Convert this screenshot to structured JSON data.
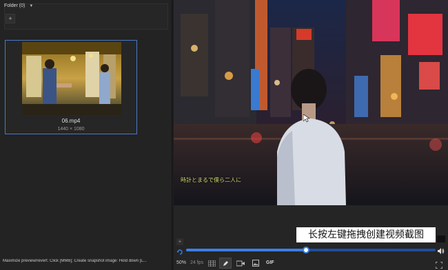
{
  "folder": {
    "title": "Folder (0)",
    "add_label": "+"
  },
  "media": [
    {
      "name": "06.mp4",
      "resolution": "1440 × 1080",
      "selected": true
    }
  ],
  "status_bar": {
    "text": "Maximize preview/revert: Click [MMB]; Create snapshot image: Hold down [L..."
  },
  "preview": {
    "subtitle": "時計とまるで僕ら二人に"
  },
  "player": {
    "add_label": "+",
    "progress": 0.48,
    "zoom": "50%",
    "fps": "24 fps",
    "gif_label": "GIF"
  },
  "overlay_tip": {
    "text": "长按左键拖拽创建视频截图"
  },
  "icons": [
    "chevron-down-icon",
    "loop-icon",
    "volume-icon",
    "grid-icon",
    "pen-icon",
    "video-icon",
    "image-icon",
    "fullscreen-icon",
    "cursor-icon"
  ],
  "colors": {
    "accent": "#3b7fe6",
    "selection": "#4a79c7",
    "panel": "#232323",
    "background": "#1d1d1d"
  }
}
